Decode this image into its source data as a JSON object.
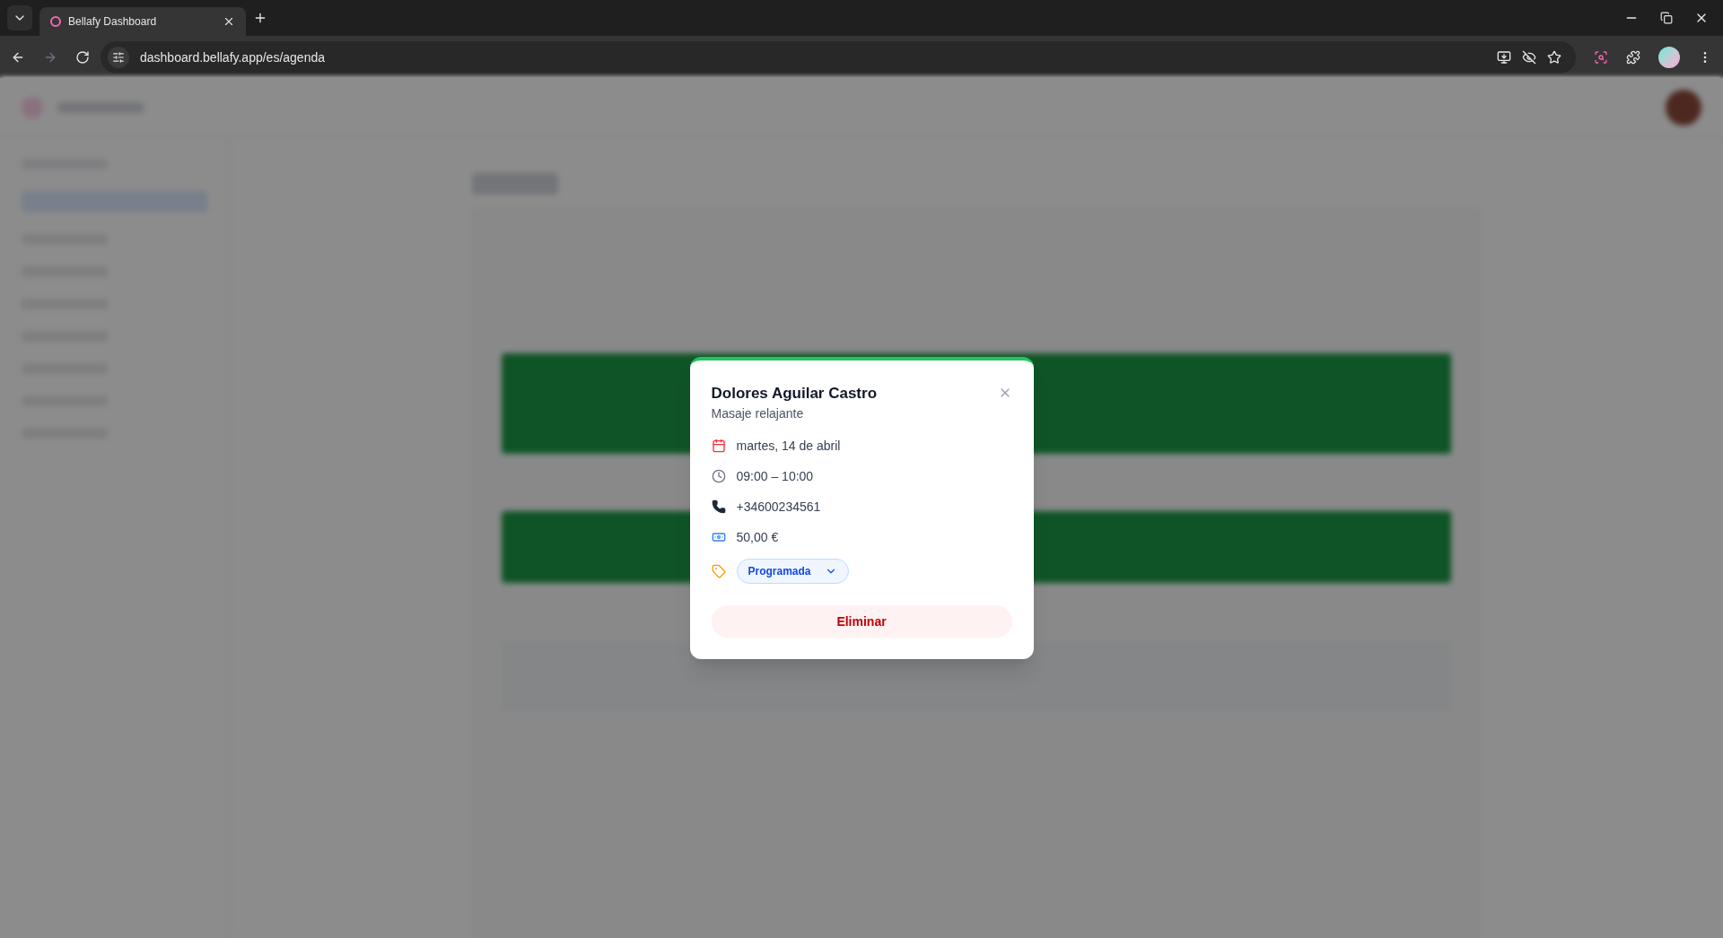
{
  "browser": {
    "tab_title": "Bellafy Dashboard",
    "url": "dashboard.bellafy.app/es/agenda"
  },
  "dialog": {
    "title": "Dolores Aguilar Castro",
    "subtitle": "Masaje relajante",
    "details": [
      {
        "kind": "date",
        "text": "martes, 14 de abril"
      },
      {
        "kind": "time",
        "text": "09:00 – 10:00"
      },
      {
        "kind": "phone",
        "text": "+34600234561"
      },
      {
        "kind": "price",
        "text": "50,00 €"
      }
    ],
    "status": {
      "value": "Programada"
    },
    "delete_button": "Eliminar"
  }
}
